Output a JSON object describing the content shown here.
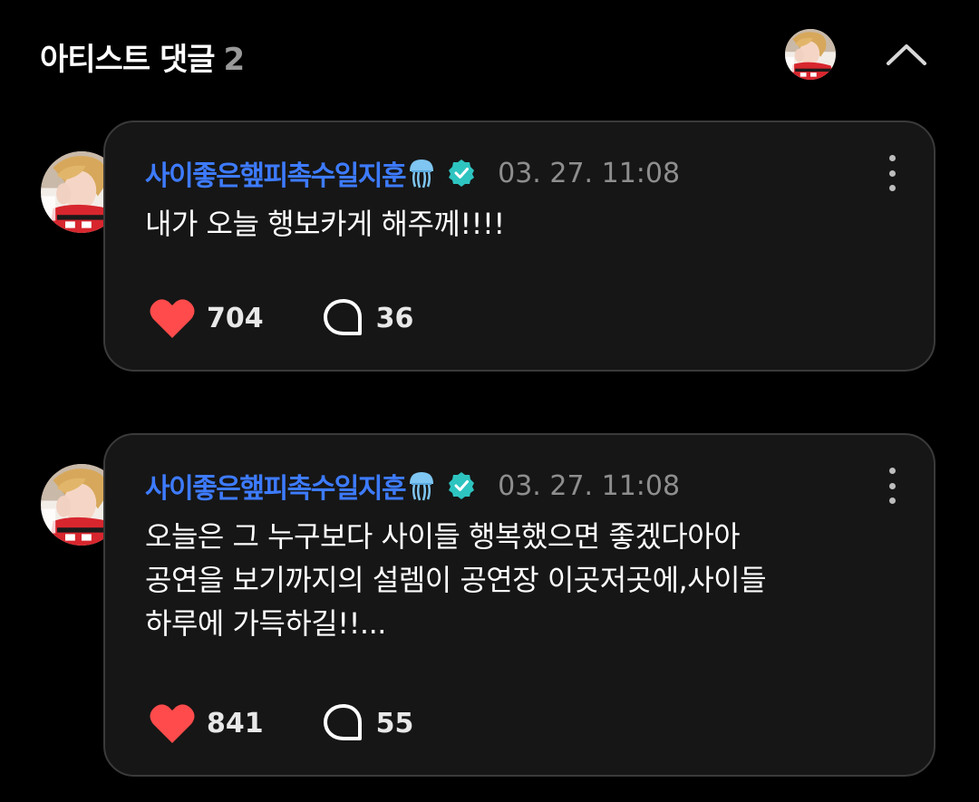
{
  "header": {
    "title": "아티스트 댓글",
    "count": "2",
    "avatar_icon": "user-avatar",
    "collapse_icon": "chevron-up-icon"
  },
  "colors": {
    "background": "#000000",
    "card": "#161616",
    "card_border": "#3a3a3a",
    "author": "#3d7bff",
    "verified": "#2ec4c0",
    "heart": "#ff4b4b",
    "timestamp": "#8e8e8e"
  },
  "comments": [
    {
      "author": "사이좋은햎피촉수일지훈",
      "author_emoji_icon": "jellyfish-icon",
      "verified_icon": "verified-badge-icon",
      "timestamp": "03. 27. 11:08",
      "lines": [
        "내가 오늘 행보카게 해주께!!!!"
      ],
      "likes": "704",
      "replies": "36"
    },
    {
      "author": "사이좋은햎피촉수일지훈",
      "author_emoji_icon": "jellyfish-icon",
      "verified_icon": "verified-badge-icon",
      "timestamp": "03. 27. 11:08",
      "lines": [
        "오늘은 그 누구보다 사이들 행복했으면 좋겠다아아",
        "공연을 보기까지의 설렘이 공연장 이곳저곳에,사이들",
        "하루에 가득하길!!..."
      ],
      "likes": "841",
      "replies": "55"
    }
  ]
}
